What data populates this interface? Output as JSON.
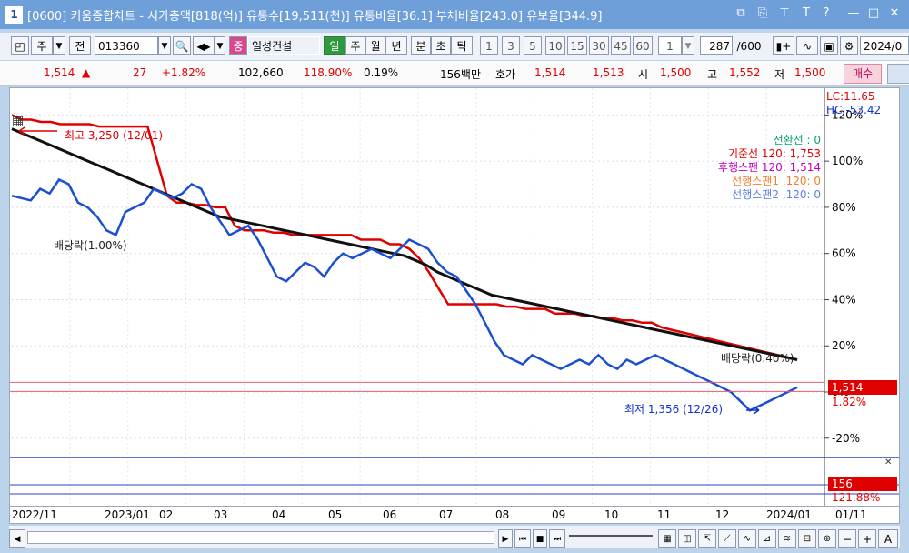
{
  "title_bar": {
    "number": "1",
    "text": "[0600] 키움종합차트 - 시가총액[818(억)] 유통수[19,511(천)] 유통비율[36.1] 부채비율[243.0] 유보율[344.9]",
    "icons": [
      "restore-icon",
      "copy-icon",
      "pin-icon",
      "font-icon",
      "help-icon",
      "minimize-icon",
      "maximize-icon",
      "close-icon"
    ],
    "icon_glyphs": [
      "⧉",
      "⎘",
      "⊤",
      "T",
      "?",
      "—",
      "□",
      "✕"
    ]
  },
  "toolbar": {
    "period_label": "주",
    "prev_label": "전",
    "stock_code": "013360",
    "stock_name": "일성건설",
    "period_buttons": [
      "일",
      "주",
      "월",
      "년",
      "분",
      "초",
      "틱"
    ],
    "interval_buttons": [
      "1",
      "3",
      "5",
      "10",
      "15",
      "30",
      "45",
      "60"
    ],
    "interval_value": "1",
    "bar_count": "287",
    "bar_max": "/600",
    "date_value": "2024/0"
  },
  "quote": {
    "price": "1,514",
    "arrow": "▲",
    "change": "27",
    "change_pct": "+1.82%",
    "volume": "102,660",
    "volume_ratio": "118.90%",
    "turnover": "0.19%",
    "amount": "156백만",
    "bid_label": "호가",
    "ask": "1,514",
    "bid": "1,513",
    "open_label": "시",
    "open": "1,500",
    "high_label": "고",
    "high": "1,552",
    "low_label": "저",
    "low": "1,500",
    "buy_label": "매수"
  },
  "chart_data": {
    "type": "line",
    "top_right": {
      "lc": "LC:11.65",
      "hc": "HC:-53.42"
    },
    "y_ticks": [
      "120%",
      "100%",
      "80%",
      "60%",
      "40%",
      "20%",
      "0%",
      "-20%"
    ],
    "y_tick_values": [
      120,
      100,
      80,
      60,
      40,
      20,
      0,
      -20
    ],
    "ylim": [
      -26,
      130
    ],
    "x_labels": [
      "2022/11",
      "2023/01",
      "02",
      "03",
      "04",
      "05",
      "06",
      "07",
      "08",
      "09",
      "10",
      "11",
      "12",
      "2024/01",
      "01/11"
    ],
    "legend": [
      {
        "label": "전환선 : 0",
        "color": "#10a070"
      },
      {
        "label": "기준선 120: 1,753",
        "color": "#e00000"
      },
      {
        "label": "후행스팬 120: 1,514",
        "color": "#c000c0"
      },
      {
        "label": "선행스팬1 ,120: 0",
        "color": "#f08030"
      },
      {
        "label": "선행스팬2 ,120: 0",
        "color": "#6080e0"
      }
    ],
    "annotations": {
      "high": "최고 3,250 (12/01)",
      "low": "최저 1,356 (12/26)",
      "overlay_left": "배당락(1.00%)",
      "overlay_right": "배당락(0.40%)"
    },
    "price_box": {
      "value": "1,514",
      "pct": "1.82%"
    },
    "volume_box": {
      "value": "156",
      "pct": "121.88%"
    },
    "series": [
      {
        "name": "기준선",
        "color": "#e00000",
        "values": [
          120,
          118,
          118,
          117,
          117,
          116,
          116,
          116,
          116,
          115,
          115,
          115,
          115,
          115,
          115,
          100,
          85,
          82,
          82,
          81,
          81,
          80,
          80,
          72,
          70,
          70,
          70,
          69,
          69,
          68,
          68,
          68,
          68,
          68,
          68,
          68,
          66,
          66,
          66,
          64,
          64,
          62,
          58,
          52,
          45,
          38,
          38,
          38,
          38,
          38,
          38,
          37,
          37,
          36,
          36,
          36,
          34,
          34,
          34,
          33,
          33,
          32,
          32,
          31,
          31,
          30,
          30,
          28,
          27,
          26,
          25,
          24,
          23,
          22,
          21,
          20,
          19,
          18,
          17,
          16,
          15,
          14
        ]
      },
      {
        "name": "Moving average",
        "color": "#111111",
        "values": [
          114,
          112,
          110,
          108,
          106,
          104,
          102,
          100,
          98,
          96,
          94,
          92,
          90,
          88,
          86,
          84,
          82,
          80,
          78,
          76,
          75,
          74,
          73,
          72,
          71,
          70,
          69,
          68,
          67,
          66,
          65,
          64,
          63,
          62,
          61,
          60,
          59,
          57,
          55,
          52,
          50,
          48,
          46,
          44,
          42,
          41,
          40,
          39,
          38,
          37,
          36,
          35,
          34,
          33,
          32,
          31,
          30,
          29,
          28,
          27,
          26,
          25,
          24,
          23,
          22,
          21,
          20,
          19,
          18,
          17,
          16,
          15,
          14
        ]
      },
      {
        "name": "Price",
        "color": "#1a4fd0",
        "values": [
          85,
          84,
          83,
          88,
          86,
          92,
          90,
          82,
          80,
          76,
          70,
          68,
          78,
          80,
          82,
          88,
          86,
          84,
          86,
          90,
          88,
          80,
          74,
          68,
          70,
          72,
          66,
          58,
          50,
          48,
          52,
          56,
          54,
          50,
          56,
          60,
          58,
          60,
          62,
          60,
          58,
          62,
          66,
          64,
          62,
          56,
          52,
          50,
          44,
          38,
          30,
          22,
          16,
          14,
          12,
          16,
          14,
          12,
          10,
          12,
          14,
          12,
          16,
          12,
          10,
          14,
          12,
          14,
          16,
          14,
          12,
          10,
          8,
          6,
          4,
          2,
          0,
          -4,
          -8,
          -6,
          -4,
          -2,
          0,
          2
        ]
      }
    ]
  }
}
